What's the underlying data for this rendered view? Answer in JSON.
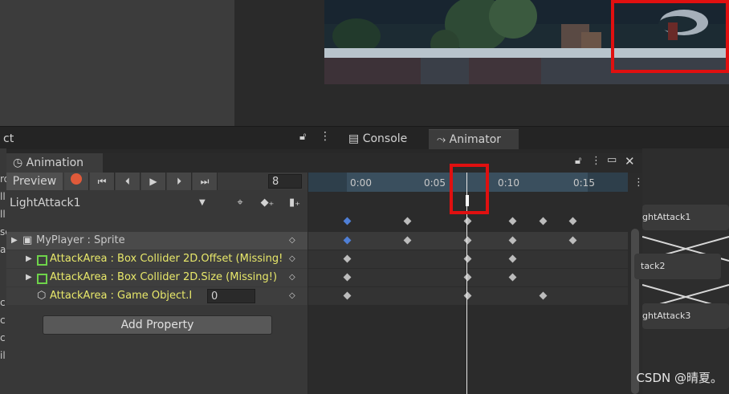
{
  "top_left_tab_fragment": "ct",
  "right_tabs": [
    {
      "label": "Console",
      "icon": "console-icon"
    },
    {
      "label": "Animator",
      "icon": "animator-icon"
    }
  ],
  "animation": {
    "tab_label": "Animation",
    "preview_label": "Preview",
    "frame_value": "8",
    "clip_name": "LightAttack1",
    "add_property_label": "Add Property",
    "properties": [
      {
        "label": "MyPlayer : Sprite",
        "color": "#c8c8c8"
      },
      {
        "label": "AttackArea : Box Collider 2D.Offset (Missing!",
        "color": "#e8e86a"
      },
      {
        "label": "AttackArea : Box Collider 2D.Size (Missing!)",
        "color": "#e8e86a"
      },
      {
        "label": "AttackArea : Game Object.I",
        "color": "#e8e86a",
        "value": "0"
      }
    ],
    "timeline_ticks": [
      "0:00",
      "0:05",
      "0:10",
      "0:15"
    ]
  },
  "left_sidebar_fragments": [
    "ro",
    "ll",
    "ll",
    "se",
    "an",
    "c",
    "c",
    "c",
    "il"
  ],
  "animator_nodes": [
    "ghtAttack1",
    "tack2",
    "ghtAttack3"
  ],
  "watermark": "CSDN @晴夏。",
  "colors": {
    "highlight": "#e01010",
    "property_yellow": "#e8e86a",
    "record": "#e05a3a",
    "keyframe_selected": "#4f7fd6"
  }
}
